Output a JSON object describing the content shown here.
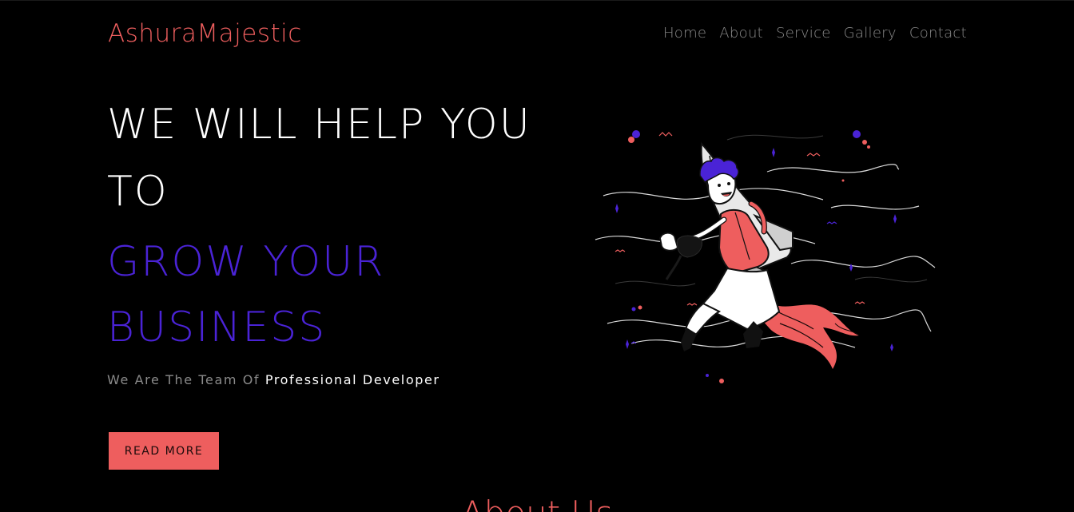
{
  "header": {
    "brand": "AshuraMajestic",
    "nav": [
      "Home",
      "About",
      "Service",
      "Gallery",
      "Contact"
    ]
  },
  "hero": {
    "line1": "WE WILL HELP YOU",
    "line2": "TO",
    "line3": "GROW YOUR",
    "line4": "BUSINESS",
    "tagline_dim": "We Are The Team Of",
    "tagline_bright": "Professional Developer",
    "button_label": "READ MORE"
  },
  "illustration": {
    "icon": "rocket-boy-illustration"
  },
  "about": {
    "heading": "About Us"
  },
  "colors": {
    "background": "#000000",
    "accent_coral": "#ee5e5e",
    "accent_purple": "#4a23d6",
    "nav_text": "#8a8a8a",
    "white": "#ffffff"
  }
}
